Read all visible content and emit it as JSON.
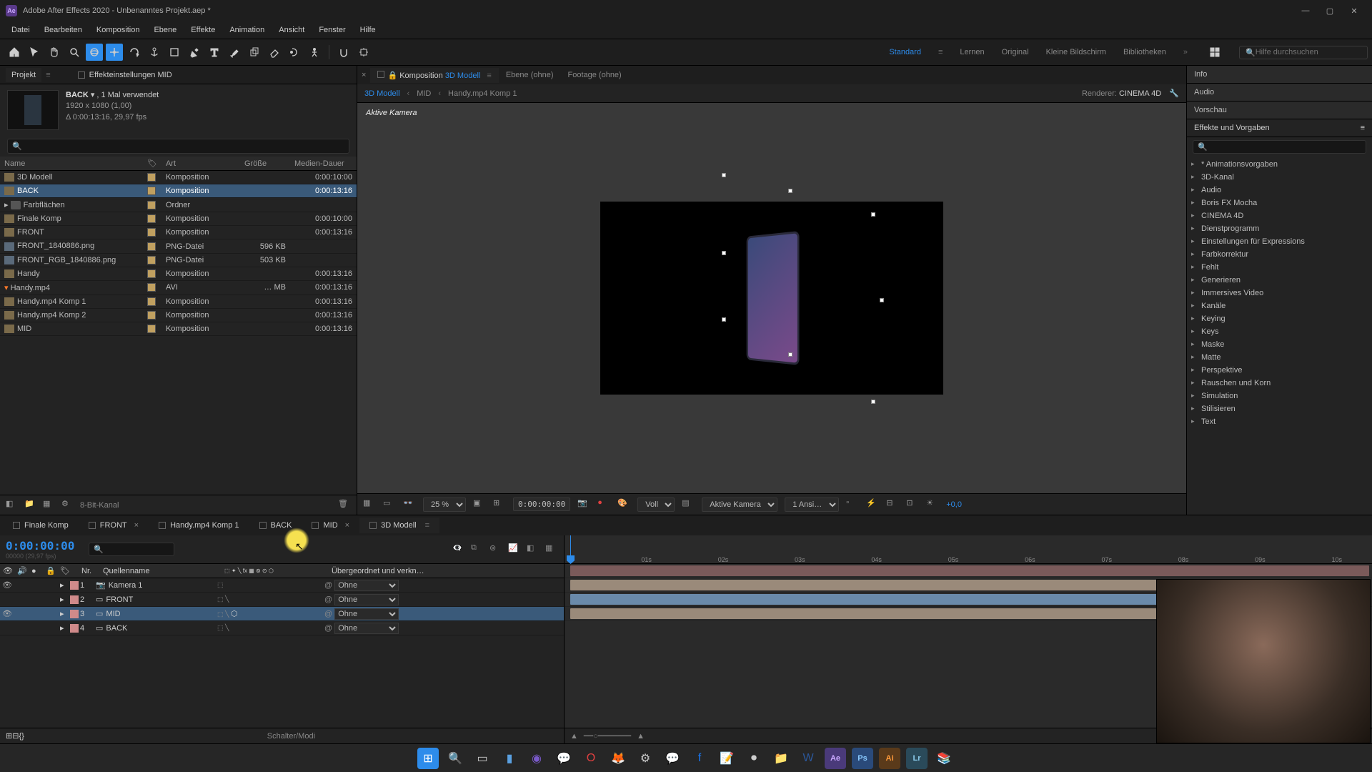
{
  "titlebar": {
    "title": "Adobe After Effects 2020 - Unbenanntes Projekt.aep *"
  },
  "menu": [
    "Datei",
    "Bearbeiten",
    "Komposition",
    "Ebene",
    "Effekte",
    "Animation",
    "Ansicht",
    "Fenster",
    "Hilfe"
  ],
  "workspaces": {
    "items": [
      "Standard",
      "Lernen",
      "Original",
      "Kleine Bildschirm",
      "Bibliotheken"
    ],
    "active": "Standard"
  },
  "help_search_placeholder": "Hilfe durchsuchen",
  "project_panel": {
    "tab_project": "Projekt",
    "tab_effects": "Effekteinstellungen  MID",
    "item_name": "BACK",
    "usage": "▾ , 1 Mal verwendet",
    "dims": "1920 x 1080 (1,00)",
    "dur": "Δ 0:00:13:16, 29,97 fps",
    "cols": {
      "name": "Name",
      "type": "Art",
      "size": "Größe",
      "dur": "Medien-Dauer"
    },
    "rows": [
      {
        "icon": "comp",
        "name": "3D Modell",
        "type": "Komposition",
        "size": "",
        "dur": "0:00:10:00"
      },
      {
        "icon": "comp",
        "name": "BACK",
        "type": "Komposition",
        "size": "",
        "dur": "0:00:13:16",
        "sel": true
      },
      {
        "icon": "folder",
        "name": "Farbflächen",
        "type": "Ordner",
        "size": "",
        "dur": ""
      },
      {
        "icon": "comp",
        "name": "Finale Komp",
        "type": "Komposition",
        "size": "",
        "dur": "0:00:10:00"
      },
      {
        "icon": "comp",
        "name": "FRONT",
        "type": "Komposition",
        "size": "",
        "dur": "0:00:13:16"
      },
      {
        "icon": "png",
        "name": "FRONT_1840886.png",
        "type": "PNG-Datei",
        "size": "596 KB",
        "dur": ""
      },
      {
        "icon": "png",
        "name": "FRONT_RGB_1840886.png",
        "type": "PNG-Datei",
        "size": "503 KB",
        "dur": ""
      },
      {
        "icon": "comp",
        "name": "Handy",
        "type": "Komposition",
        "size": "",
        "dur": "0:00:13:16"
      },
      {
        "icon": "avi",
        "name": "Handy.mp4",
        "type": "AVI",
        "size": "… MB",
        "dur": "0:00:13:16"
      },
      {
        "icon": "comp",
        "name": "Handy.mp4 Komp 1",
        "type": "Komposition",
        "size": "",
        "dur": "0:00:13:16"
      },
      {
        "icon": "comp",
        "name": "Handy.mp4 Komp 2",
        "type": "Komposition",
        "size": "",
        "dur": "0:00:13:16"
      },
      {
        "icon": "comp",
        "name": "MID",
        "type": "Komposition",
        "size": "",
        "dur": "0:00:13:16"
      }
    ],
    "bit_label": "8-Bit-Kanal"
  },
  "comp_panel": {
    "tab_comp_prefix": "Komposition",
    "tab_comp_name": "3D Modell",
    "tab_layer": "Ebene  (ohne)",
    "tab_footage": "Footage  (ohne)",
    "crumbs": [
      "3D Modell",
      "MID",
      "Handy.mp4 Komp 1"
    ],
    "renderer_label": "Renderer:",
    "renderer": "CINEMA 4D",
    "active_cam": "Aktive Kamera",
    "zoom": "25 %",
    "time": "0:00:00:00",
    "res": "Voll",
    "view": "Aktive Kamera",
    "ansi": "1 Ansi…",
    "exposure": "+0,0"
  },
  "right_panels": {
    "info": "Info",
    "audio": "Audio",
    "preview": "Vorschau",
    "effects_title": "Effekte und Vorgaben",
    "effects": [
      "* Animationsvorgaben",
      "3D-Kanal",
      "Audio",
      "Boris FX Mocha",
      "CINEMA 4D",
      "Dienstprogramm",
      "Einstellungen für Expressions",
      "Farbkorrektur",
      "Fehlt",
      "Generieren",
      "Immersives Video",
      "Kanäle",
      "Keying",
      "Keys",
      "Maske",
      "Matte",
      "Perspektive",
      "Rauschen und Korn",
      "Simulation",
      "Stilisieren",
      "Text"
    ]
  },
  "timeline": {
    "tabs": [
      "Finale Komp",
      "FRONT",
      "Handy.mp4 Komp 1",
      "BACK",
      "MID",
      "3D Modell"
    ],
    "active_tab": "3D Modell",
    "time": "0:00:00:00",
    "fps_label": "00000 (29,97 fps)",
    "cols": {
      "nr": "Nr.",
      "src": "Quellenname",
      "parent": "Übergeordnet und verkn…"
    },
    "layers": [
      {
        "nr": "1",
        "color": "#d08a8a",
        "icon": "camera",
        "name": "Kamera 1",
        "vis": true,
        "parent": "Ohne"
      },
      {
        "nr": "2",
        "color": "#d08a8a",
        "icon": "comp",
        "name": "FRONT",
        "vis": false,
        "parent": "Ohne"
      },
      {
        "nr": "3",
        "color": "#d08a8a",
        "icon": "comp",
        "name": "MID",
        "vis": true,
        "sel": true,
        "parent": "Ohne",
        "cube": true
      },
      {
        "nr": "4",
        "color": "#d08a8a",
        "icon": "comp",
        "name": "BACK",
        "vis": false,
        "parent": "Ohne"
      }
    ],
    "ticks": [
      "01s",
      "02s",
      "03s",
      "04s",
      "05s",
      "06s",
      "07s",
      "08s",
      "09s",
      "10s"
    ],
    "foot": "Schalter/Modi"
  },
  "taskbar_icons": [
    "windows",
    "search",
    "taskview",
    "explorer",
    "teams",
    "whatsapp",
    "opera",
    "firefox",
    "app",
    "messenger",
    "facebook",
    "notes",
    "obs",
    "folder",
    "word",
    "ae",
    "ps",
    "ai",
    "lr",
    "stack"
  ]
}
